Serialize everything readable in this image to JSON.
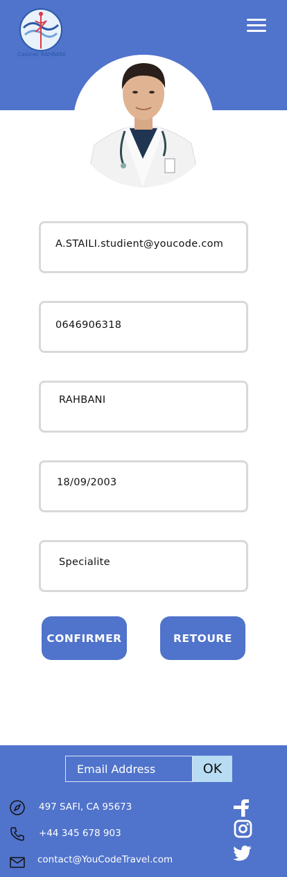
{
  "header": {
    "logo_icon": "cabinet-logo-icon",
    "logo_text": "Cabinet RAHBANI",
    "menu_icon": "hamburger-menu-icon",
    "brand_color": "#5073cb"
  },
  "profile": {
    "avatar_icon": "doctor-avatar"
  },
  "form": {
    "email": "A.STAILI.studient@youcode.com",
    "phone": "0646906318",
    "name": "RAHBANI",
    "birthdate": "18/09/2003",
    "specialty": "Specialite"
  },
  "actions": {
    "confirm_label": "CONFIRMER",
    "back_label": "RETOURE"
  },
  "footer": {
    "newsletter_placeholder": "Email Address",
    "ok_label": "OK",
    "address": "497  SAFI, CA 95673",
    "phone": "+44 345 678 903",
    "email": "contact@YouCodeTravel.com",
    "address_icon": "compass-icon",
    "phone_icon": "phone-icon",
    "email_icon": "mail-icon",
    "social": [
      "facebook-icon",
      "instagram-icon",
      "twitter-icon"
    ]
  }
}
